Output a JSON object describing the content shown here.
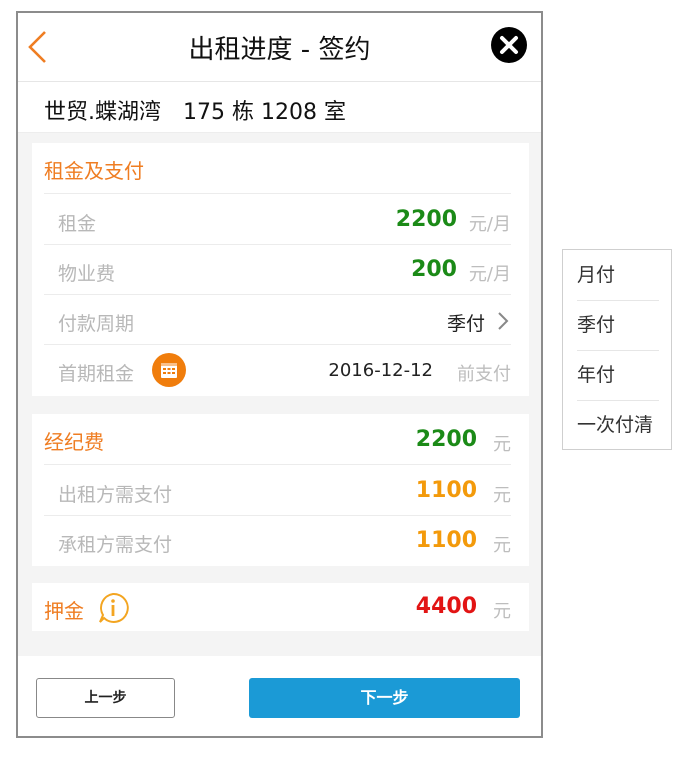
{
  "header": {
    "title": "出租进度 - 签约"
  },
  "address": "世贸.蝶湖湾　175 栋 1208 室",
  "rent_section": {
    "title": "租金及支付",
    "rent": {
      "label": "租金",
      "value": "2200",
      "unit": "元/月"
    },
    "property_fee": {
      "label": "物业费",
      "value": "200",
      "unit": "元/月"
    },
    "payment_cycle": {
      "label": "付款周期",
      "value": "季付"
    },
    "first_rent": {
      "label": "首期租金",
      "date": "2016-12-12",
      "suffix": "前支付"
    }
  },
  "agency_section": {
    "title": "经纪费",
    "value": "2200",
    "unit": "元",
    "landlord": {
      "label": "出租方需支付",
      "value": "1100",
      "unit": "元"
    },
    "tenant": {
      "label": "承租方需支付",
      "value": "1100",
      "unit": "元"
    }
  },
  "deposit_section": {
    "title": "押金",
    "value": "4400",
    "unit": "元"
  },
  "footer": {
    "prev_label": "上一步",
    "next_label": "下一步"
  },
  "payment_options": [
    "月付",
    "季付",
    "年付",
    "一次付清"
  ],
  "colors": {
    "accent": "#ef7d22",
    "green": "#1b8a17",
    "orange": "#f39a0b",
    "red": "#e21414",
    "primary": "#1b9ad6"
  }
}
